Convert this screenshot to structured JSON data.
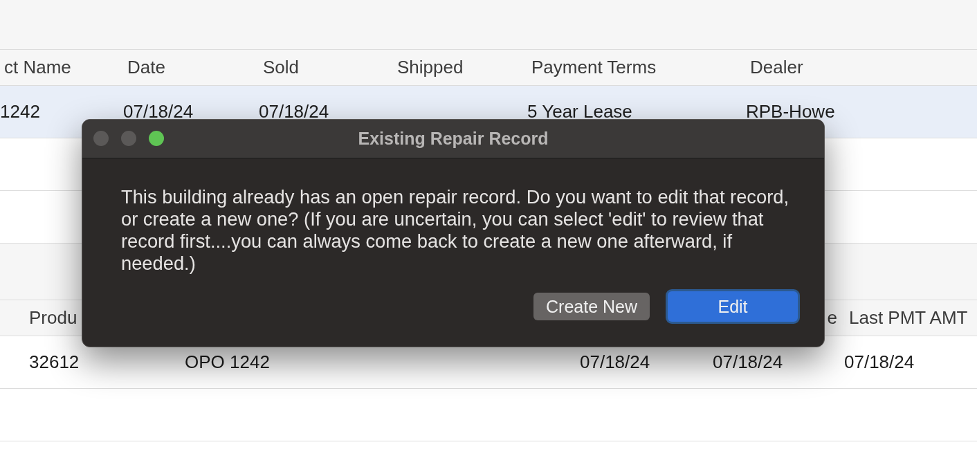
{
  "table_1": {
    "columns": [
      "ct Name",
      "Date",
      "Sold",
      "Shipped",
      "Payment Terms",
      "Dealer"
    ],
    "rows": [
      {
        "selected": true,
        "cells": [
          "1242",
          "07/18/24",
          "07/18/24",
          "",
          "5 Year Lease",
          "RPB-Howe"
        ]
      },
      {
        "selected": false,
        "cells": []
      },
      {
        "selected": false,
        "cells": []
      }
    ]
  },
  "table_2": {
    "columns": [
      "Produ",
      "",
      "",
      "e",
      "Last PMT AMT"
    ],
    "rows": [
      {
        "selected": false,
        "cells": [
          "32612",
          "OPO 1242",
          "07/18/24",
          "07/18/24",
          "07/18/24"
        ]
      },
      {
        "selected": false,
        "cells": []
      }
    ]
  },
  "dialog": {
    "title": "Existing Repair Record",
    "message": "This building already has an open repair record. Do you want to edit that record, or create a new one? (If you are uncertain, you can select 'edit' to review that record first....you can always come back to create a new one afterward, if needed.)",
    "buttons": [
      {
        "label": "Create New",
        "default": false
      },
      {
        "label": "Edit",
        "default": true
      }
    ]
  }
}
